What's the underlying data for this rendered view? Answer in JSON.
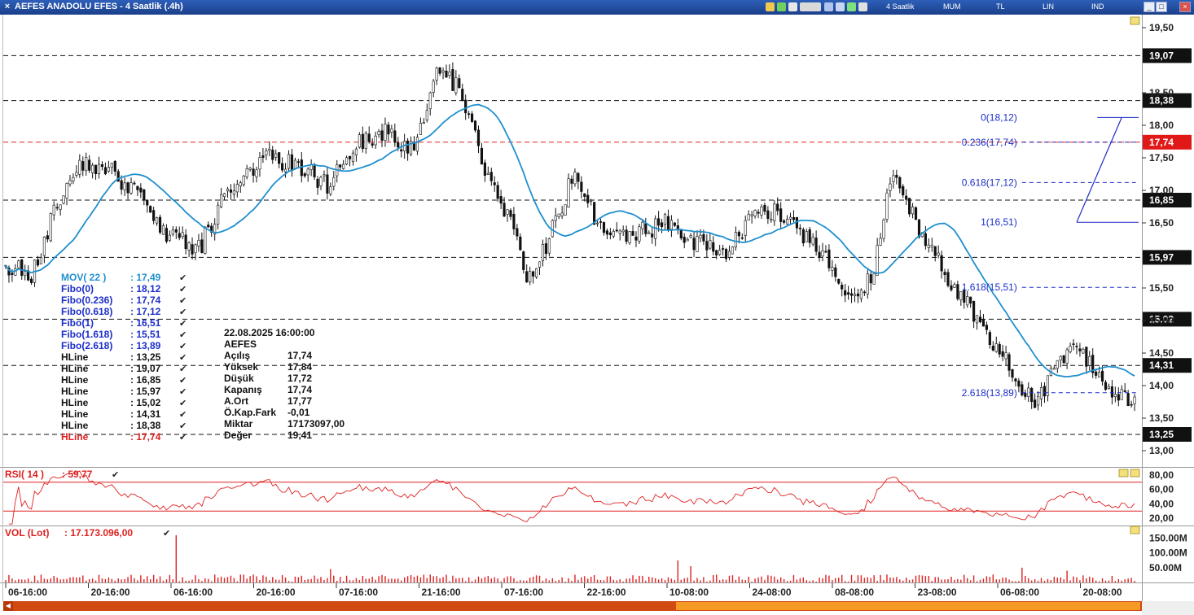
{
  "window": {
    "title": "AEFES ANADOLU EFES - 4 Saatlik (.4h)",
    "close_glyph": "×",
    "toolbar": {
      "icons": [
        "chart-icon",
        "stock-icon",
        "refresh-icon",
        "template-icon",
        "link-icon",
        "copy-icon",
        "draw-icon",
        "settings-icon"
      ],
      "period": "4 Saatlik",
      "chart_type": "MUM",
      "currency": "TL",
      "scale": "LIN",
      "indicators": "IND"
    },
    "buttons": {
      "minimize": "_",
      "maximize": "□",
      "close": "×"
    }
  },
  "colors": {
    "candle": "#111111",
    "ma": "#1f8fcf",
    "hline": "#111111",
    "hline_active": "#e02020",
    "fibo": "#1c2fc8",
    "rsi": "#e02020",
    "volume": "#e02020",
    "label_bg": "#111111",
    "label_active_bg": "#e01818"
  },
  "chart_data": [
    {
      "type": "candlestick",
      "symbol": "AEFES",
      "yaxis_ticks": [
        19.5,
        18.5,
        18.0,
        17.5,
        17.0,
        16.5,
        15.5,
        15.0,
        14.5,
        14.0,
        13.5,
        13.0
      ],
      "yaxis_tick_labels": [
        "19,50",
        "18,50",
        "18,00",
        "17,50",
        "17,00",
        "16,50",
        "15,50",
        "15,00",
        "14,50",
        "14,00",
        "13,50",
        "13,00"
      ],
      "ylim": [
        12.75,
        19.7
      ],
      "x_tick_labels": [
        "06-16:00",
        "20-16:00",
        "06-16:00",
        "20-16:00",
        "07-16:00",
        "21-16:00",
        "07-16:00",
        "22-16:00",
        "10-08:00",
        "24-08:00",
        "08-08:00",
        "23-08:00",
        "06-08:00",
        "20-08:00"
      ],
      "bar_count": 352,
      "close_path_anchors": [
        [
          0,
          15.85
        ],
        [
          8,
          15.7
        ],
        [
          20,
          17.3
        ],
        [
          28,
          17.4
        ],
        [
          40,
          17.05
        ],
        [
          50,
          16.3
        ],
        [
          60,
          16.1
        ],
        [
          70,
          17.1
        ],
        [
          80,
          17.5
        ],
        [
          90,
          17.4
        ],
        [
          100,
          17.1
        ],
        [
          110,
          17.7
        ],
        [
          118,
          17.9
        ],
        [
          127,
          17.6
        ],
        [
          134,
          18.95
        ],
        [
          142,
          18.5
        ],
        [
          149,
          17.3
        ],
        [
          156,
          16.6
        ],
        [
          163,
          15.6
        ],
        [
          170,
          16.4
        ],
        [
          177,
          17.3
        ],
        [
          185,
          16.4
        ],
        [
          195,
          16.3
        ],
        [
          205,
          16.5
        ],
        [
          215,
          16.2
        ],
        [
          225,
          16.05
        ],
        [
          235,
          16.8
        ],
        [
          243,
          16.5
        ],
        [
          253,
          16.1
        ],
        [
          263,
          15.4
        ],
        [
          269,
          15.6
        ],
        [
          276,
          17.3
        ],
        [
          286,
          16.2
        ],
        [
          294,
          15.6
        ],
        [
          303,
          14.9
        ],
        [
          312,
          14.3
        ],
        [
          320,
          13.7
        ],
        [
          330,
          14.6
        ],
        [
          338,
          14.35
        ],
        [
          345,
          13.9
        ],
        [
          352,
          13.65
        ]
      ],
      "ma_label": "MOV( 22 )",
      "ma_value": "17,49",
      "hlines": [
        {
          "label": "HLine",
          "price": 13.25,
          "tag": "13,25",
          "style": "dashed-black"
        },
        {
          "label": "HLine",
          "price": 19.07,
          "tag": "19,07",
          "style": "dashed-black"
        },
        {
          "label": "HLine",
          "price": 16.85,
          "tag": "16,85",
          "style": "dashed-black"
        },
        {
          "label": "HLine",
          "price": 15.97,
          "tag": "15,97",
          "style": "dashed-black"
        },
        {
          "label": "HLine",
          "price": 15.02,
          "tag": "15,02",
          "style": "dashed-black"
        },
        {
          "label": "HLine",
          "price": 14.31,
          "tag": "14,31",
          "style": "dashed-black"
        },
        {
          "label": "HLine",
          "price": 18.38,
          "tag": "18,38",
          "style": "dashed-black"
        },
        {
          "label": "HLine",
          "price": 17.74,
          "tag": "17,74",
          "style": "dashed-red"
        }
      ],
      "fibo": [
        {
          "ratio": "0",
          "price": 18.12,
          "chart_label": "0(18,12)",
          "legend_value": "18,12"
        },
        {
          "ratio": "0.236",
          "price": 17.74,
          "chart_label": "0.236(17,74)",
          "legend_value": "17,74"
        },
        {
          "ratio": "0.618",
          "price": 17.12,
          "chart_label": "0.618(17,12)",
          "legend_value": "17,12"
        },
        {
          "ratio": "1",
          "price": 16.51,
          "chart_label": "1(16,51)",
          "legend_value": "16,51"
        },
        {
          "ratio": "1.618",
          "price": 15.51,
          "chart_label": "1.618(15,51)",
          "legend_value": "15,51"
        },
        {
          "ratio": "2.618",
          "price": 13.89,
          "chart_label": "2.618(13,89)",
          "legend_value": "13,89"
        }
      ],
      "info_box": {
        "datetime": "22.08.2025   16:00:00",
        "symbol": "AEFES",
        "rows": [
          {
            "label": "Açılış",
            "value": "17,74"
          },
          {
            "label": "Yüksek",
            "value": "17,84"
          },
          {
            "label": "Düşük",
            "value": "17,72"
          },
          {
            "label": "Kapanış",
            "value": "17,74"
          },
          {
            "label": "A.Ort",
            "value": "17,77"
          },
          {
            "label": "Ö.Kap.Fark",
            "value": "-0,01"
          },
          {
            "label": "Miktar",
            "value": "17173097,00"
          },
          {
            "label": "Değer",
            "value": "19,41"
          }
        ]
      }
    },
    {
      "type": "line",
      "name": "RSI( 14 )",
      "value": "59,77",
      "ylim": [
        10,
        90
      ],
      "levels": [
        70,
        30
      ],
      "yaxis_ticks": [
        80,
        60,
        40,
        20
      ],
      "yaxis_tick_labels": [
        "80,00",
        "60,00",
        "40,00",
        "20,00"
      ]
    },
    {
      "type": "bar",
      "name": "VOL (Lot)",
      "value": "17.173.096,00",
      "ylim": [
        0,
        190000000
      ],
      "yaxis_ticks": [
        150000000,
        100000000,
        50000000
      ],
      "yaxis_tick_labels": [
        "150.00M",
        "100.00M",
        "50.00M"
      ],
      "peak_values": [
        160000000,
        75000000,
        55000000,
        50000000,
        45000000,
        40000000
      ]
    }
  ]
}
